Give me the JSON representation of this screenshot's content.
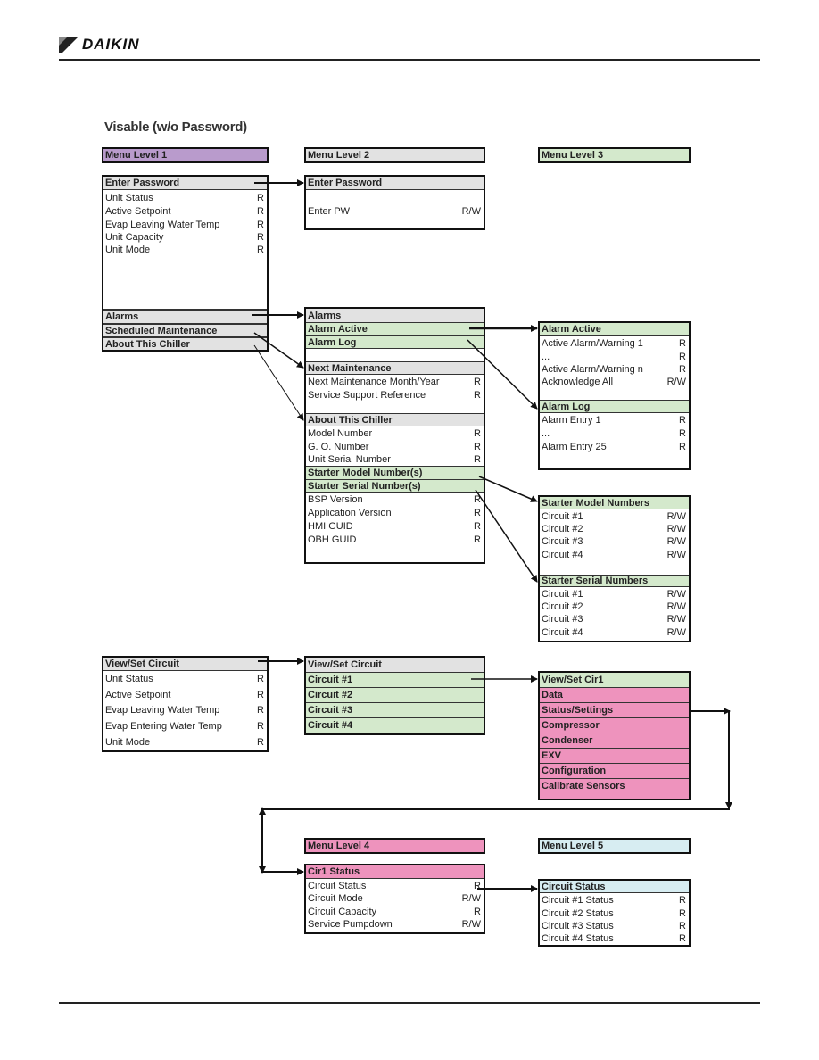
{
  "brand": {
    "name": "DAIKIN",
    "logo_icon": "daikin-logo-icon"
  },
  "page_title": "Visable (w/o Password)",
  "legend": {
    "level1": {
      "label": "Menu Level 1",
      "color": "#b99bcc"
    },
    "level2": {
      "label": "Menu Level 2",
      "color": "#e2e2e2"
    },
    "level3": {
      "label": "Menu Level 3",
      "color": "#d4e9cc"
    },
    "level4": {
      "label": "Menu Level 4",
      "color": "#ee93bd"
    },
    "level5": {
      "label": "Menu Level 5",
      "color": "#d7edf2"
    }
  },
  "level1_main": {
    "header": "Enter Password",
    "items": [
      {
        "label": "Unit Status",
        "perm": "R"
      },
      {
        "label": "Active Setpoint",
        "perm": "R"
      },
      {
        "label": "Evap Leaving Water Temp",
        "perm": "R"
      },
      {
        "label": "Unit Capacity",
        "perm": "R"
      },
      {
        "label": "Unit Mode",
        "perm": "R"
      }
    ],
    "links": [
      "Alarms",
      "Scheduled Maintenance",
      "About This Chiller"
    ]
  },
  "level2_password": {
    "header": "Enter Password",
    "items": [
      {
        "label": "Enter PW",
        "perm": "R/W"
      }
    ]
  },
  "level2_alarms": {
    "header": "Alarms",
    "links": [
      "Alarm Active",
      "Alarm Log"
    ]
  },
  "level2_maintenance": {
    "header": "Next Maintenance",
    "items": [
      {
        "label": "Next Maintenance Month/Year",
        "perm": "R"
      },
      {
        "label": "Service Support Reference",
        "perm": "R"
      }
    ]
  },
  "level2_about": {
    "header": "About This Chiller",
    "items_top": [
      {
        "label": "Model Number",
        "perm": "R"
      },
      {
        "label": "G. O. Number",
        "perm": "R"
      },
      {
        "label": "Unit Serial Number",
        "perm": "R"
      }
    ],
    "links": [
      "Starter Model Number(s)",
      "Starter Serial Number(s)"
    ],
    "items_bottom": [
      {
        "label": "BSP Version",
        "perm": "R"
      },
      {
        "label": "Application Version",
        "perm": "R"
      },
      {
        "label": "HMI GUID",
        "perm": "R"
      },
      {
        "label": "OBH GUID",
        "perm": "R"
      }
    ]
  },
  "level3_alarm_active": {
    "header": "Alarm Active",
    "items": [
      {
        "label": "Active Alarm/Warning 1",
        "perm": "R"
      },
      {
        "label": "...",
        "perm": "R"
      },
      {
        "label": "Active Alarm/Warning n",
        "perm": "R"
      },
      {
        "label": "Acknowledge All",
        "perm": "R/W"
      }
    ]
  },
  "level3_alarm_log": {
    "header": "Alarm Log",
    "items": [
      {
        "label": "Alarm Entry 1",
        "perm": "R"
      },
      {
        "label": "...",
        "perm": "R"
      },
      {
        "label": "Alarm Entry 25",
        "perm": "R"
      }
    ]
  },
  "level3_starter_model": {
    "header": "Starter Model Numbers",
    "items": [
      {
        "label": "Circuit #1",
        "perm": "R/W"
      },
      {
        "label": "Circuit #2",
        "perm": "R/W"
      },
      {
        "label": "Circuit #3",
        "perm": "R/W"
      },
      {
        "label": "Circuit #4",
        "perm": "R/W"
      }
    ]
  },
  "level3_starter_serial": {
    "header": "Starter Serial Numbers",
    "items": [
      {
        "label": "Circuit #1",
        "perm": "R/W"
      },
      {
        "label": "Circuit #2",
        "perm": "R/W"
      },
      {
        "label": "Circuit #3",
        "perm": "R/W"
      },
      {
        "label": "Circuit #4",
        "perm": "R/W"
      }
    ]
  },
  "level1_circuit": {
    "header": "View/Set Circuit",
    "items": [
      {
        "label": "Unit Status",
        "perm": "R"
      },
      {
        "label": "Active Setpoint",
        "perm": "R"
      },
      {
        "label": "Evap Leaving Water Temp",
        "perm": "R"
      },
      {
        "label": "Evap Entering Water Temp",
        "perm": "R"
      },
      {
        "label": "Unit Mode",
        "perm": "R"
      }
    ]
  },
  "level2_circuit": {
    "header": "View/Set Circuit",
    "links": [
      "Circuit #1",
      "Circuit #2",
      "Circuit #3",
      "Circuit #4"
    ]
  },
  "level3_cir1": {
    "header": "View/Set Cir1",
    "links": [
      "Data",
      "Status/Settings",
      "Compressor",
      "Condenser",
      "EXV",
      "Configuration",
      "Calibrate Sensors"
    ]
  },
  "level4_cir1_status": {
    "header": "Cir1 Status",
    "items": [
      {
        "label": "Circuit Status",
        "perm": "R"
      },
      {
        "label": "Circuit Mode",
        "perm": "R/W"
      },
      {
        "label": "Circuit Capacity",
        "perm": "R"
      },
      {
        "label": "Service Pumpdown",
        "perm": "R/W"
      }
    ]
  },
  "level5_circuit_status": {
    "header": "Circuit Status",
    "items": [
      {
        "label": "Circuit #1 Status",
        "perm": "R"
      },
      {
        "label": "Circuit #2 Status",
        "perm": "R"
      },
      {
        "label": "Circuit #3 Status",
        "perm": "R"
      },
      {
        "label": "Circuit #4 Status",
        "perm": "R"
      }
    ]
  }
}
